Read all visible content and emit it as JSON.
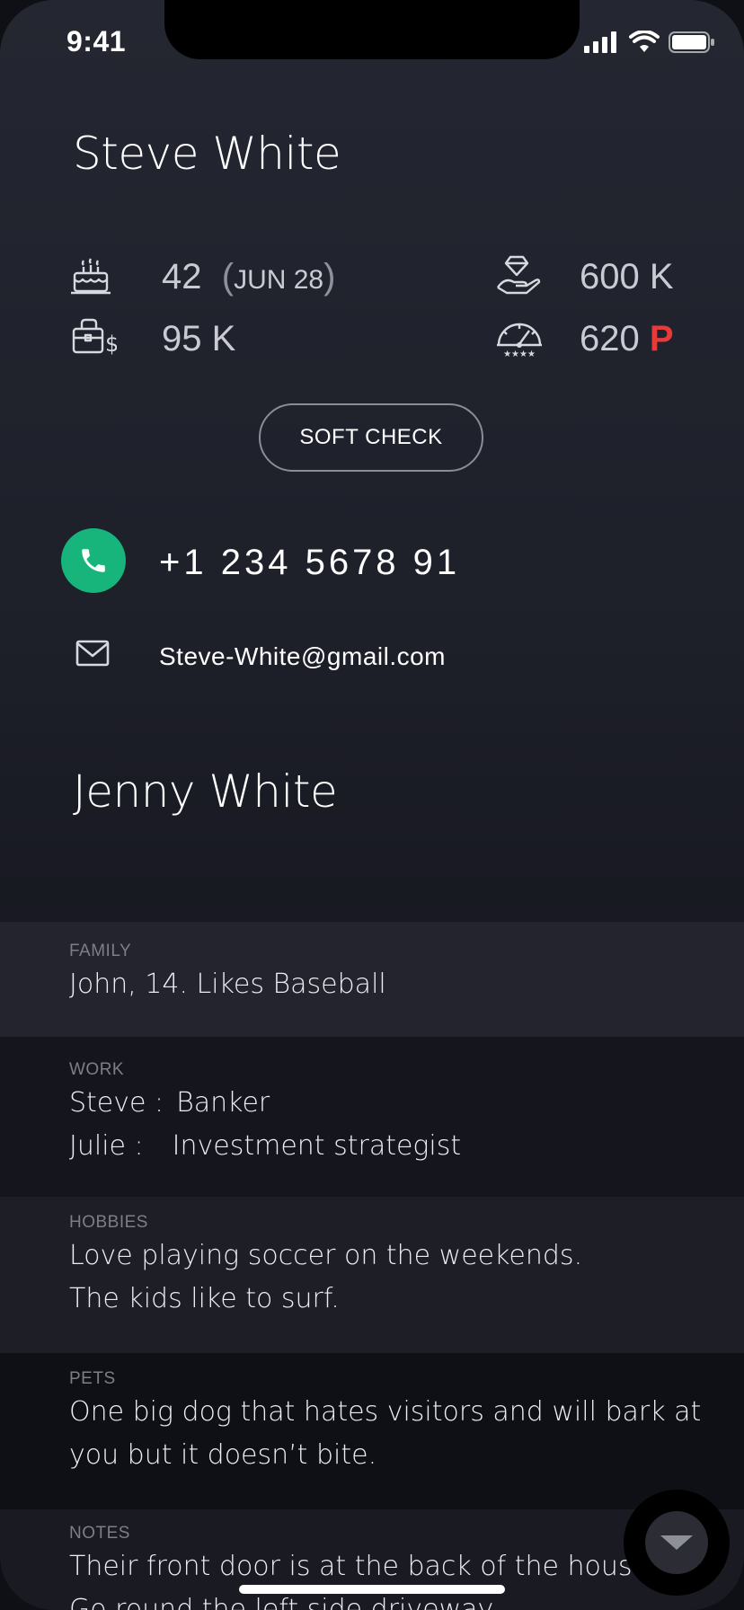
{
  "status_bar": {
    "time": "9:41"
  },
  "primary_contact": {
    "name": "Steve White",
    "age": "42",
    "birthday": "JUN 28",
    "income": "95 K",
    "net_worth": "600 K",
    "credit_score": "620",
    "credit_flag": "P",
    "credit_flag_color": "#e83a3a"
  },
  "soft_check_label": "SOFT CHECK",
  "phone": {
    "number": "+1 234 5678 91",
    "button_color": "#17b57c"
  },
  "email": "Steve-White@gmail.com",
  "secondary_contact": {
    "name": "Jenny White"
  },
  "sections": {
    "family": {
      "label": "FAMILY",
      "text": "John, 14. Likes Baseball"
    },
    "work": {
      "label": "WORK",
      "lines": [
        {
          "key": "Steve :",
          "value": "Banker"
        },
        {
          "key": "Julie :",
          "value": "Investment strategist"
        }
      ]
    },
    "hobbies": {
      "label": "HOBBIES",
      "lines": [
        "Love playing soccer on the weekends.",
        "The kids like to surf."
      ]
    },
    "pets": {
      "label": "PETS",
      "lines": [
        "One big dog that hates visitors and will bark at",
        "you but it doesn’t bite."
      ]
    },
    "notes": {
      "label": "NOTES",
      "lines": [
        "Their front door is at the back of the house.",
        "Go round the left side driveway."
      ]
    }
  },
  "icons": {
    "birthday": "birthday-cake-icon",
    "income": "briefcase-dollar-icon",
    "net_worth": "diamond-hand-icon",
    "credit": "credit-gauge-icon",
    "phone": "phone-icon",
    "email": "mail-icon",
    "fab": "chevron-down-icon"
  }
}
